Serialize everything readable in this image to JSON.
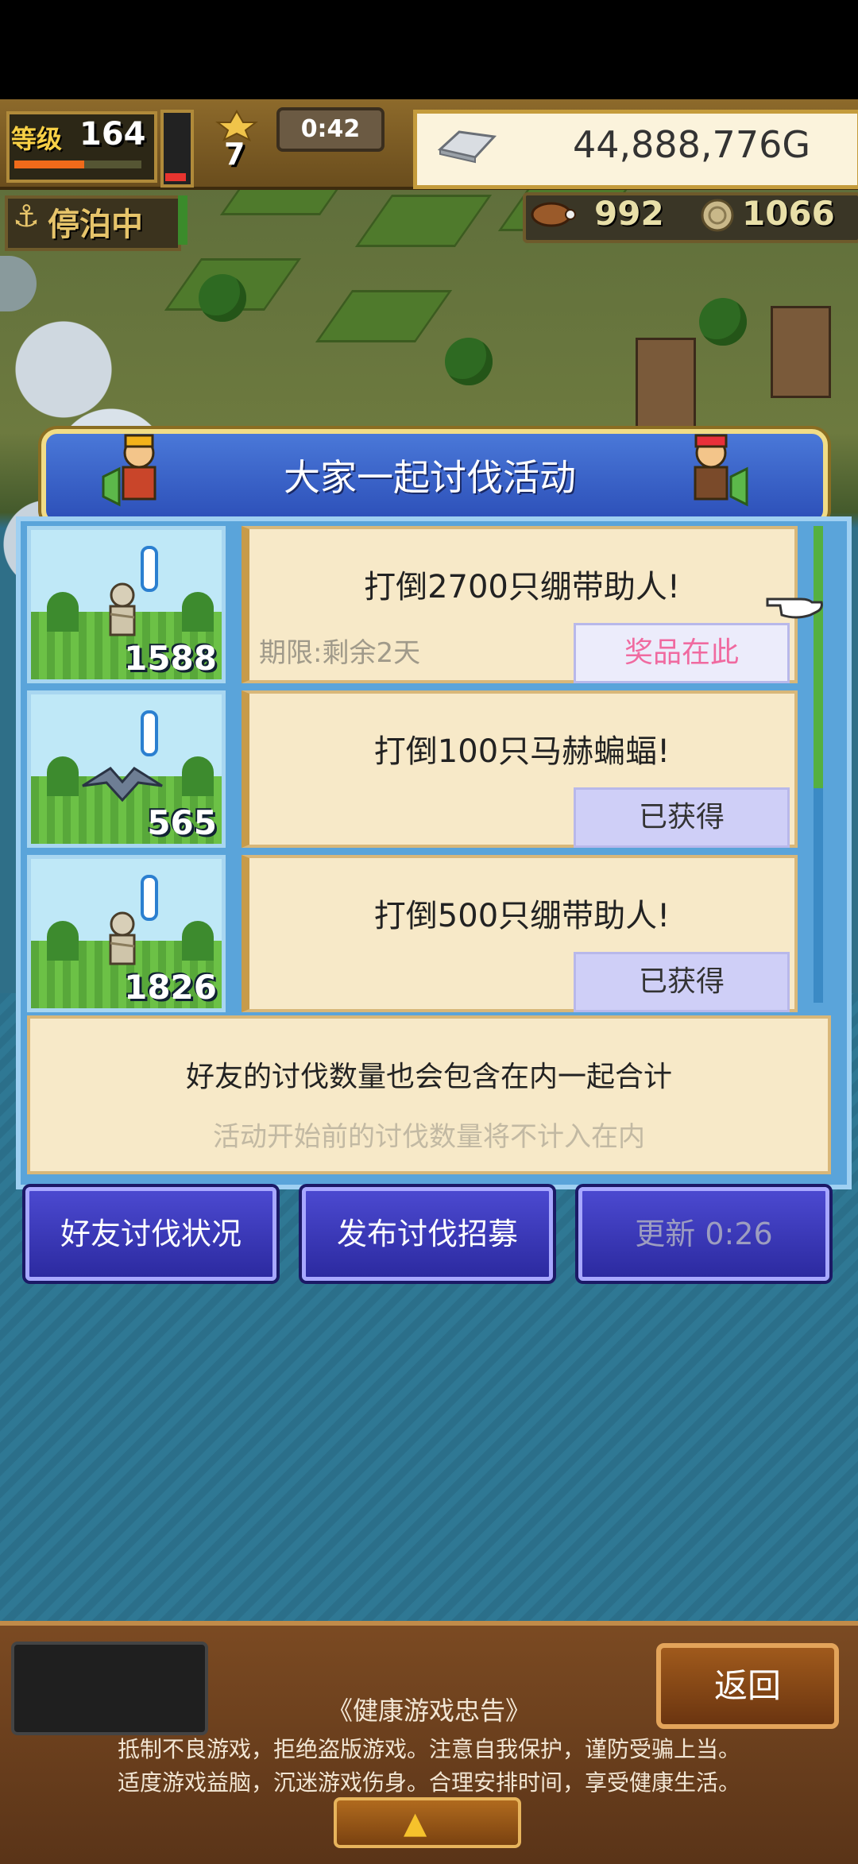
{
  "hud": {
    "level_label": "等级",
    "level": "164",
    "level_progress": 0.55,
    "stamina_level": 0.12,
    "stars": "7",
    "timer": "0:42",
    "money": "44,888,776G",
    "dock_status": "停泊中",
    "resource1": "992",
    "resource2": "1066"
  },
  "dialog": {
    "title": "大家一起讨伐活动",
    "missions": [
      {
        "count": "1588",
        "title": "打倒2700只绷带助人!",
        "deadline": "期限:剩余2天",
        "button": "奖品在此"
      },
      {
        "count": "565",
        "title": "打倒100只马赫蝙蝠!",
        "deadline": "",
        "button": "已获得"
      },
      {
        "count": "1826",
        "title": "打倒500只绷带助人!",
        "deadline": "",
        "button": "已获得"
      }
    ],
    "note_main": "好友的讨伐数量也会包含在内一起合计",
    "note_sub": "活动开始前的讨伐数量将不计入在内"
  },
  "actions": {
    "friend_status": "好友讨伐状况",
    "post_recruit": "发布讨伐招募",
    "refresh": "更新 0:26"
  },
  "bottom": {
    "back": "返回",
    "health_title": "《健康游戏忠告》",
    "health_line1": "抵制不良游戏，拒绝盗版游戏。注意自我保护，谨防受骗上当。",
    "health_line2": "适度游戏益脑，沉迷游戏伤身。合理安排时间，享受健康生活。"
  },
  "colors": {
    "accent_blue": "#2c4fb8",
    "card_bg": "#f7e9c8",
    "claimed_btn": "#cfcff7",
    "prize_text": "#f06aa0"
  }
}
